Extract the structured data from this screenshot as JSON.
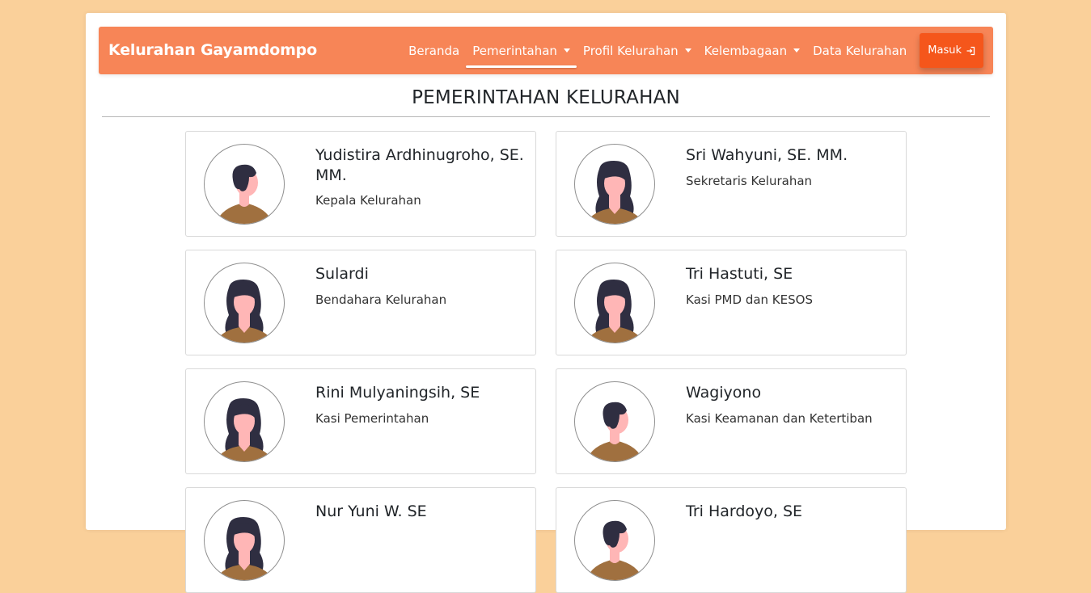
{
  "navbar": {
    "brand": "Kelurahan Gayamdompo",
    "items": [
      {
        "label": "Beranda",
        "dropdown": false,
        "active": false
      },
      {
        "label": "Pemerintahan",
        "dropdown": true,
        "active": true
      },
      {
        "label": "Profil Kelurahan",
        "dropdown": true,
        "active": false
      },
      {
        "label": "Kelembagaan",
        "dropdown": true,
        "active": false
      },
      {
        "label": "Data Kelurahan",
        "dropdown": false,
        "active": false
      }
    ],
    "login_label": "Masuk",
    "login_icon": "login-icon"
  },
  "main": {
    "title": "PEMERINTAHAN KELURAHAN",
    "officials": [
      {
        "name": "Yudistira Ardhinugroho, SE. MM.",
        "role": "Kepala Kelurahan",
        "avatar": "male-avatar-icon"
      },
      {
        "name": "Sri Wahyuni, SE. MM.",
        "role": "Sekretaris Kelurahan",
        "avatar": "female-avatar-icon"
      },
      {
        "name": "Sulardi",
        "role": "Bendahara Kelurahan",
        "avatar": "female-avatar-icon"
      },
      {
        "name": "Tri Hastuti, SE",
        "role": "Kasi PMD dan KESOS",
        "avatar": "female-avatar-icon"
      },
      {
        "name": "Rini Mulyaningsih, SE",
        "role": "Kasi Pemerintahan",
        "avatar": "female-avatar-icon"
      },
      {
        "name": "Wagiyono",
        "role": "Kasi Keamanan dan Ketertiban",
        "avatar": "male-avatar-icon"
      },
      {
        "name": "Nur Yuni W. SE",
        "role": "",
        "avatar": "female-avatar-icon"
      },
      {
        "name": "Tri Hardoyo, SE",
        "role": "",
        "avatar": "male-avatar-icon"
      }
    ]
  },
  "colors": {
    "background": "#fad09a",
    "navbar": "#f78557",
    "login_button": "#f5561b",
    "avatar_hair": "#2f2e41",
    "avatar_skin": "#ffb6b6",
    "avatar_shirt": "#a0703f"
  }
}
